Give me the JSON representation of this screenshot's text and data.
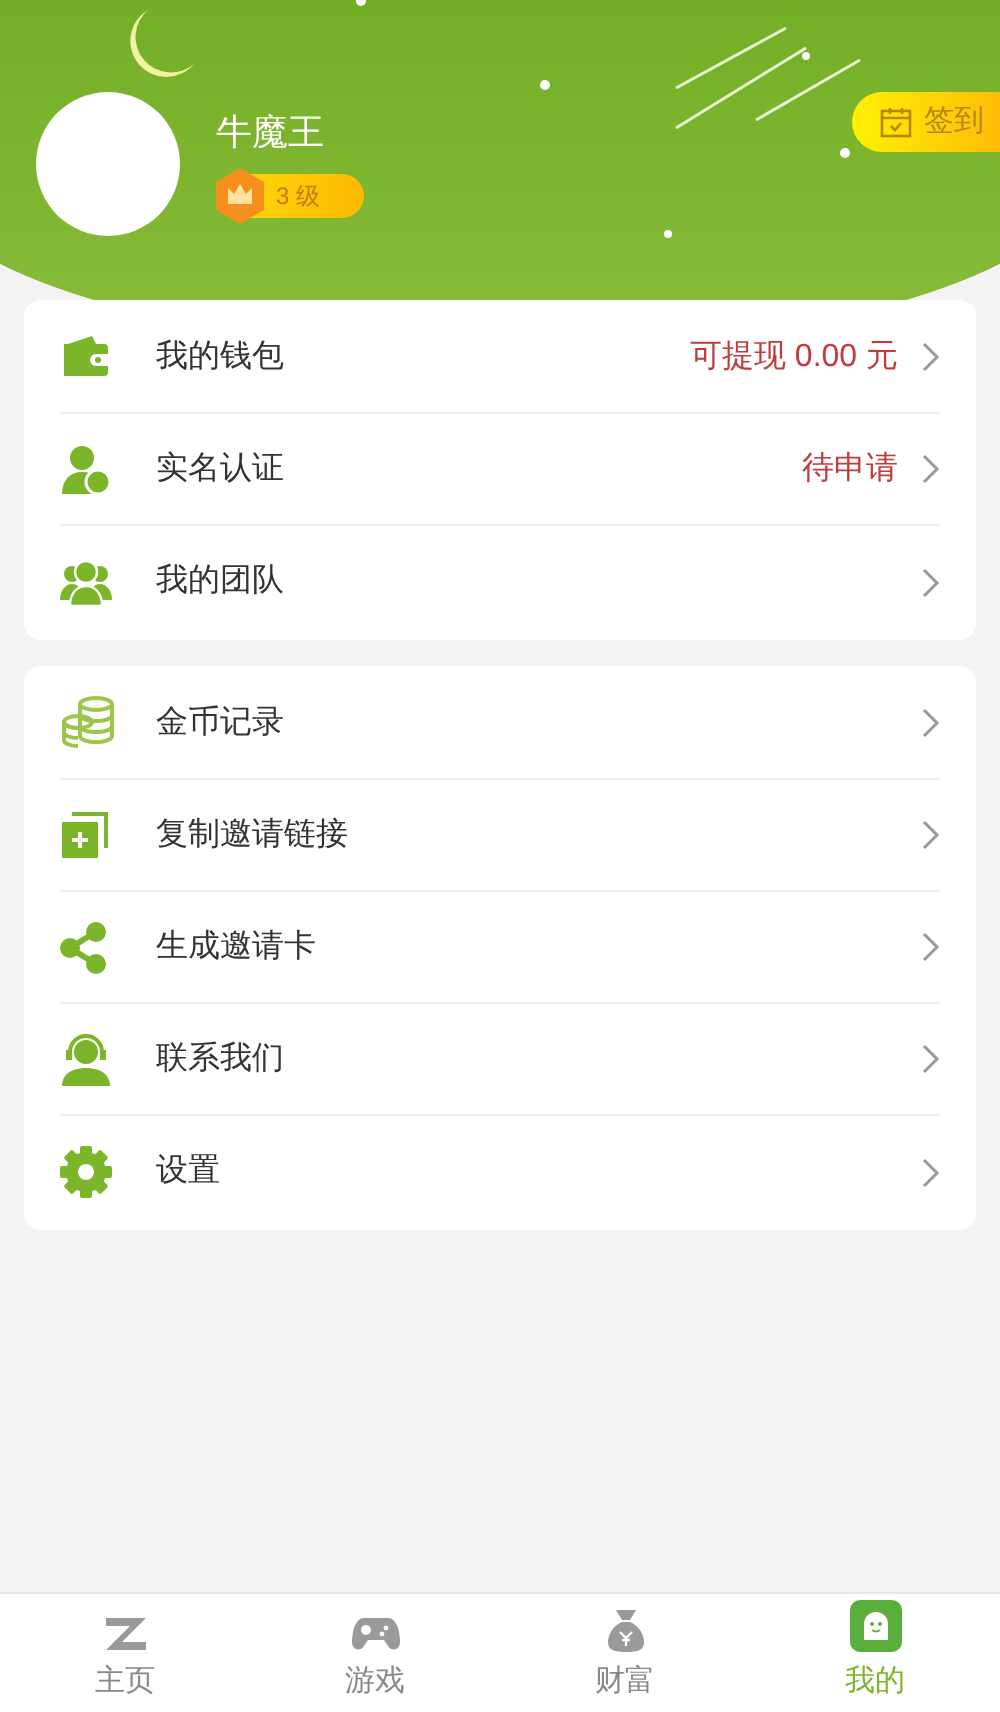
{
  "profile": {
    "name": "牛魔王",
    "level_badge": "3 级",
    "checkin_button": "签到"
  },
  "menu_groups": [
    {
      "items": [
        {
          "label": "我的钱包",
          "value": "可提现 0.00 元"
        },
        {
          "label": "实名认证",
          "value": "待申请"
        },
        {
          "label": "我的团队"
        }
      ]
    },
    {
      "items": [
        {
          "label": "金币记录"
        },
        {
          "label": "复制邀请链接"
        },
        {
          "label": "生成邀请卡"
        },
        {
          "label": "联系我们"
        },
        {
          "label": "设置"
        }
      ]
    }
  ],
  "tab_bar": [
    {
      "label": "主页",
      "selected": false
    },
    {
      "label": "游戏",
      "selected": false
    },
    {
      "label": "财富",
      "selected": false
    },
    {
      "label": "我的",
      "selected": true
    }
  ]
}
